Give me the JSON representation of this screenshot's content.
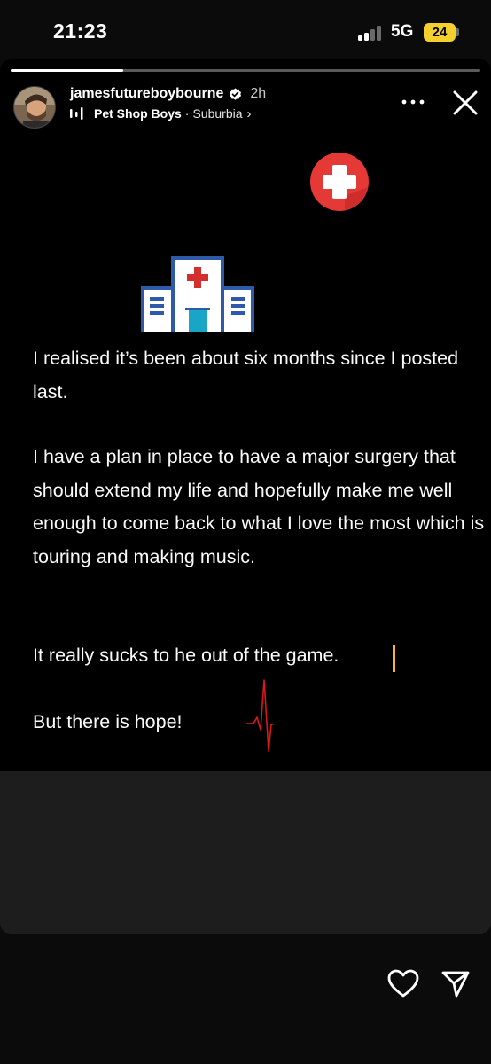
{
  "status_bar": {
    "time": "21:23",
    "network": "5G",
    "battery": "24",
    "battery_color": "#f3d02e"
  },
  "story": {
    "progress": 0.24,
    "username": "jamesfutureboybourne",
    "verified": true,
    "time_ago": "2h",
    "music": {
      "artist": "Pet Shop Boys",
      "separator": "·",
      "song": "Suburbia",
      "chevron": "›"
    },
    "icons": {
      "more": "more-horizontal-icon",
      "close": "close-icon",
      "medical_cross": "medical-cross-icon",
      "hospital": "hospital-building-icon",
      "heartbeat": "heartbeat-icon",
      "like": "heart-outline-icon",
      "share": "paper-plane-icon"
    },
    "paragraphs": [
      "I realised it’s been about six months since I posted last.",
      "I have a plan in place to have a major surgery that should extend my life and hopefully make me well enough to come back to what I love the most which is touring and making music.",
      "It really sucks to he out of the game.",
      "But there is hope!"
    ],
    "colors": {
      "cursor": "#f2b632",
      "cross_red": "#e53935",
      "heartbeat_red": "#d61a1a"
    }
  }
}
